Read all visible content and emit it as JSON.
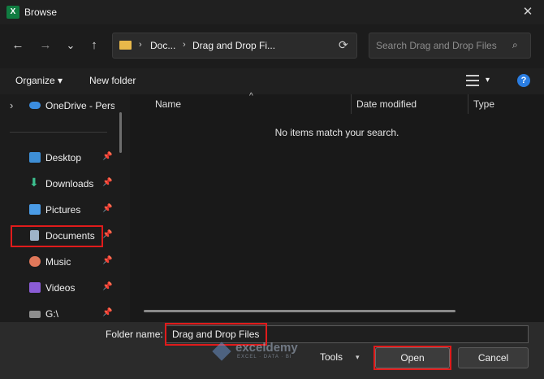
{
  "window": {
    "title": "Browse",
    "app_icon_letter": "X"
  },
  "nav": {
    "back": "←",
    "forward": "→",
    "recent": "⌄",
    "up": "↑"
  },
  "address": {
    "crumbs": [
      "Doc...",
      "Drag and Drop Fi..."
    ],
    "chevron": "›"
  },
  "search": {
    "placeholder": "Search Drag and Drop Files"
  },
  "toolbar": {
    "organize_label": "Organize",
    "organize_arrow": "▾",
    "new_folder_label": "New folder",
    "view_arrow": "▾",
    "help": "?"
  },
  "sidebar": {
    "items": [
      {
        "label": "OneDrive - Perso",
        "icon": "cloud-icon",
        "expand": "›"
      },
      {
        "label": "Desktop",
        "icon": "desktop-icon",
        "pin": "📌"
      },
      {
        "label": "Downloads",
        "icon": "download-icon",
        "pin": "📌"
      },
      {
        "label": "Pictures",
        "icon": "pictures-icon",
        "pin": "📌"
      },
      {
        "label": "Documents",
        "icon": "documents-icon",
        "pin": "📌"
      },
      {
        "label": "Music",
        "icon": "music-icon",
        "pin": "📌"
      },
      {
        "label": "Videos",
        "icon": "videos-icon",
        "pin": "📌"
      },
      {
        "label": "G:\\",
        "icon": "drive-icon",
        "pin": "📌"
      }
    ]
  },
  "columns": [
    "Name",
    "Date modified",
    "Type"
  ],
  "sort_arrow": "^",
  "empty_message": "No items match your search.",
  "footer": {
    "folder_name_label": "Folder name:",
    "folder_name_value": "Drag and Drop Files",
    "tools_label": "Tools",
    "tools_arrow": "▾",
    "open_label": "Open",
    "cancel_label": "Cancel"
  },
  "watermark": {
    "name": "exceldemy",
    "tagline": "EXCEL · DATA · BI"
  },
  "colors": {
    "highlight": "#e01b1b",
    "accent": "#2a7de1",
    "folder": "#e8b84a",
    "excel": "#107c41"
  }
}
